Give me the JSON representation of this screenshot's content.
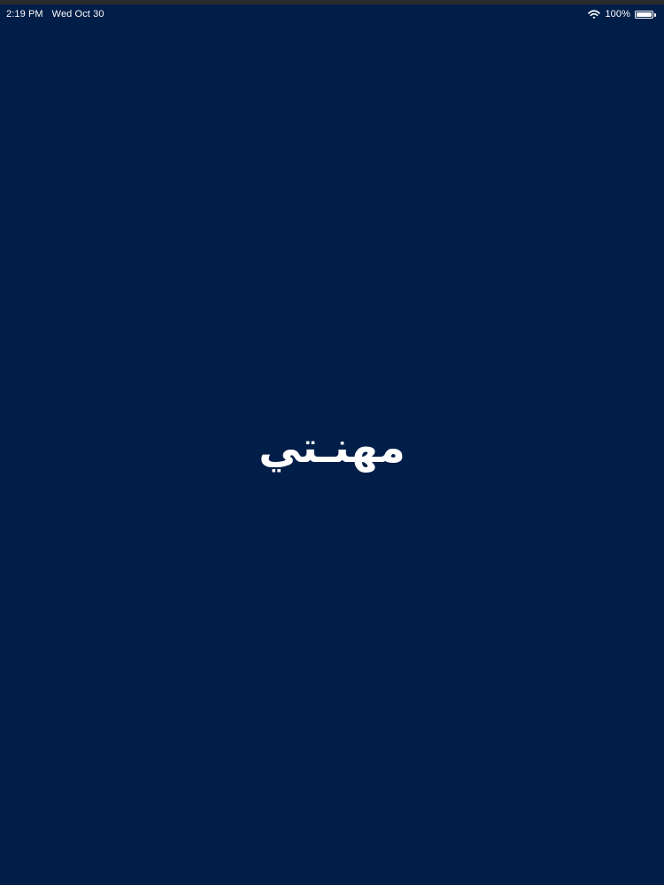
{
  "status_bar": {
    "time": "2:19 PM",
    "date": "Wed Oct 30",
    "battery_text": "100%",
    "battery_level": 1.0,
    "icons": [
      "wifi-icon",
      "battery-icon"
    ]
  },
  "splash": {
    "logo_text": "مهنـتي",
    "background_color": "#001e48",
    "text_color": "#ffffff"
  }
}
